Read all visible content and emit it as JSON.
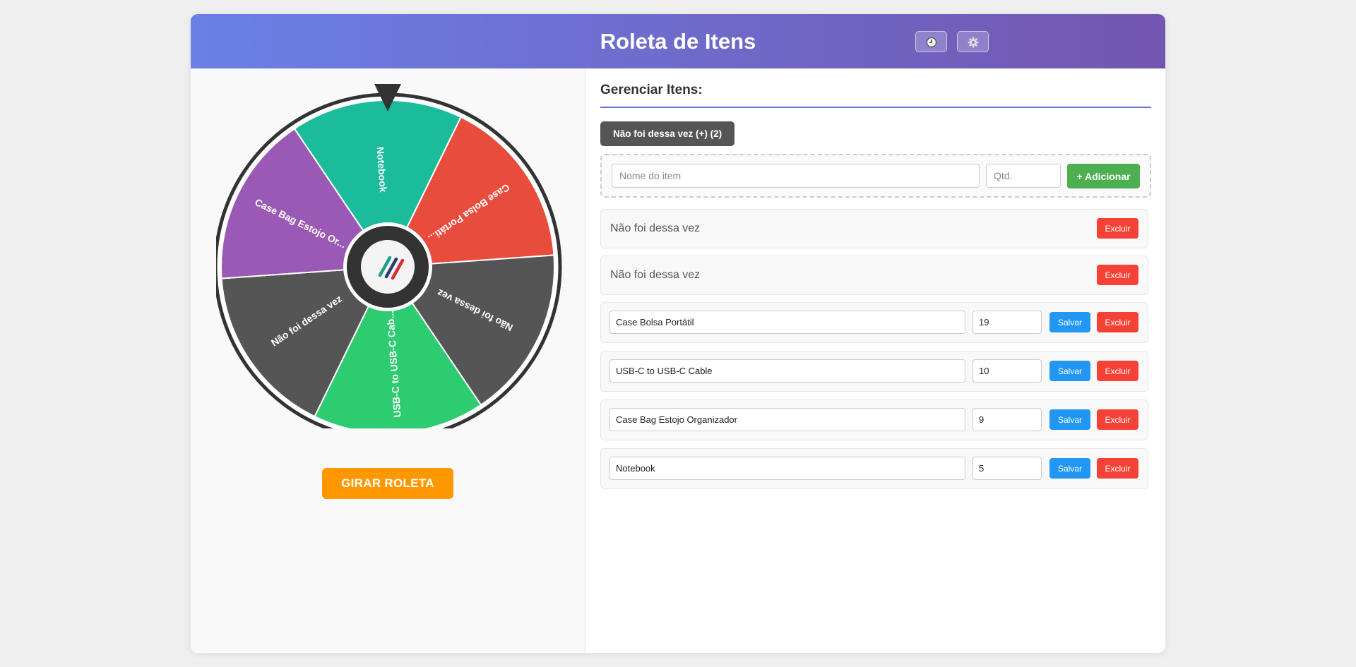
{
  "header": {
    "title": "Roleta de Itens",
    "history_icon": "clock-icon",
    "settings_icon": "gear-icon"
  },
  "wheel": {
    "pointer_icon": "pointer-triangle-icon",
    "center_icon": "logo-icon",
    "segments": [
      {
        "label": "Case Bolsa Portáti...",
        "color": "#e74c3c"
      },
      {
        "label": "Não foi dessa vez",
        "color": "#555555"
      },
      {
        "label": "USB-C to USB-C Cab...",
        "color": "#2ecc71"
      },
      {
        "label": "Não foi dessa vez",
        "color": "#555555"
      },
      {
        "label": "Case Bag Estojo Or...",
        "color": "#9b59b6"
      },
      {
        "label": "Notebook",
        "color": "#1abc9c"
      }
    ],
    "spin_label": "GIRAR ROLETA"
  },
  "manage": {
    "title": "Gerenciar Itens:",
    "tag_label": "Não foi dessa vez (+) (2)",
    "name_placeholder": "Nome do item",
    "qty_placeholder": "Qtd.",
    "add_label": "+ Adicionar",
    "static_items": [
      {
        "label": "Não foi dessa vez",
        "delete_label": "Excluir"
      },
      {
        "label": "Não foi dessa vez",
        "delete_label": "Excluir"
      }
    ],
    "items": [
      {
        "name": "Case Bolsa Portátil",
        "qty": "19",
        "save_label": "Salvar",
        "delete_label": "Excluir"
      },
      {
        "name": "USB-C to USB-C Cable",
        "qty": "10",
        "save_label": "Salvar",
        "delete_label": "Excluir"
      },
      {
        "name": "Case Bag Estojo Organizador",
        "qty": "9",
        "save_label": "Salvar",
        "delete_label": "Excluir"
      },
      {
        "name": "Notebook",
        "qty": "5",
        "save_label": "Salvar",
        "delete_label": "Excluir"
      }
    ]
  },
  "colors": {
    "accent": "#6a74d8",
    "spin": "#ff9800",
    "add": "#4caf50",
    "save": "#2196f3",
    "delete": "#f44336"
  }
}
